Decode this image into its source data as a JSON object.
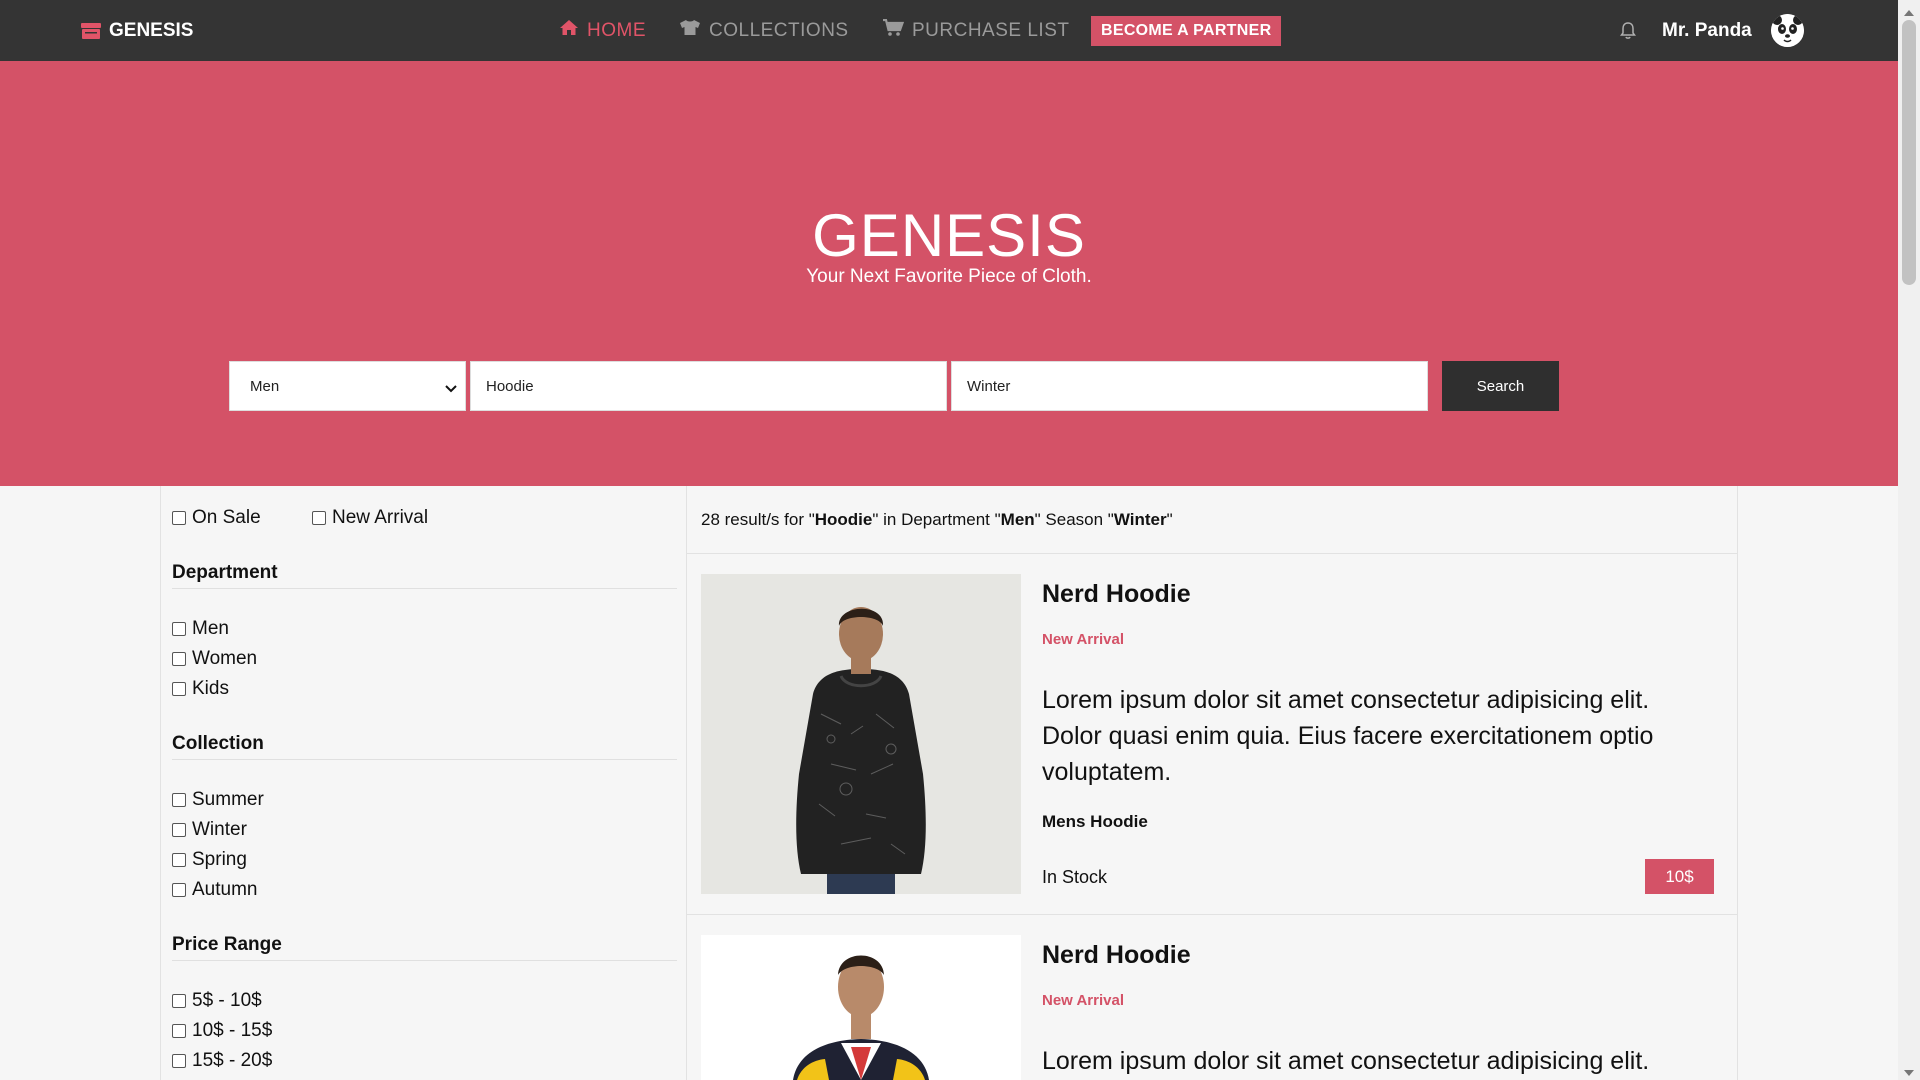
{
  "nav": {
    "brand": "GENESIS",
    "brand_icon": "store-icon",
    "items": [
      {
        "label": "HOME",
        "icon": "home-icon",
        "active": true
      },
      {
        "label": "COLLECTIONS",
        "icon": "tshirt-icon",
        "active": false
      },
      {
        "label": "PURCHASE LIST",
        "icon": "cart-icon",
        "active": false
      }
    ],
    "partner_button": "BECOME A PARTNER",
    "user_name": "Mr. Panda",
    "accent_color": "#e15468"
  },
  "hero": {
    "title": "GENESIS",
    "subtitle": "Your Next Favorite Piece of Cloth.",
    "department_value": "Men",
    "query_value": "Hoodie",
    "season_value": "Winter",
    "search_button": "Search",
    "background_color": "#d45267"
  },
  "filters": {
    "quick": [
      "On Sale",
      "New Arrival"
    ],
    "department": {
      "title": "Department",
      "options": [
        "Men",
        "Women",
        "Kids"
      ]
    },
    "collection": {
      "title": "Collection",
      "options": [
        "Summer",
        "Winter",
        "Spring",
        "Autumn"
      ]
    },
    "price_range": {
      "title": "Price Range",
      "options": [
        "5$ - 10$",
        "10$ - 15$",
        "15$ - 20$"
      ]
    }
  },
  "results": {
    "count_text": "28 result/s for \"",
    "query": "Hoodie",
    "mid_text": "\" in Department \"",
    "department": "Men",
    "season_text": "\" Season \"",
    "season": "Winter",
    "end_text": "\"",
    "products": [
      {
        "title": "Nerd Hoodie",
        "badge": "New Arrival",
        "description": "Lorem ipsum dolor sit amet consectetur adipisicing elit. Dolor quasi enim quia. Eius facere exercitationem optio voluptatem.",
        "subtitle": "Mens Hoodie",
        "stock": "In Stock",
        "price": "10$"
      },
      {
        "title": "Nerd Hoodie",
        "badge": "New Arrival",
        "description": "Lorem ipsum dolor sit amet consectetur adipisicing elit."
      }
    ]
  }
}
